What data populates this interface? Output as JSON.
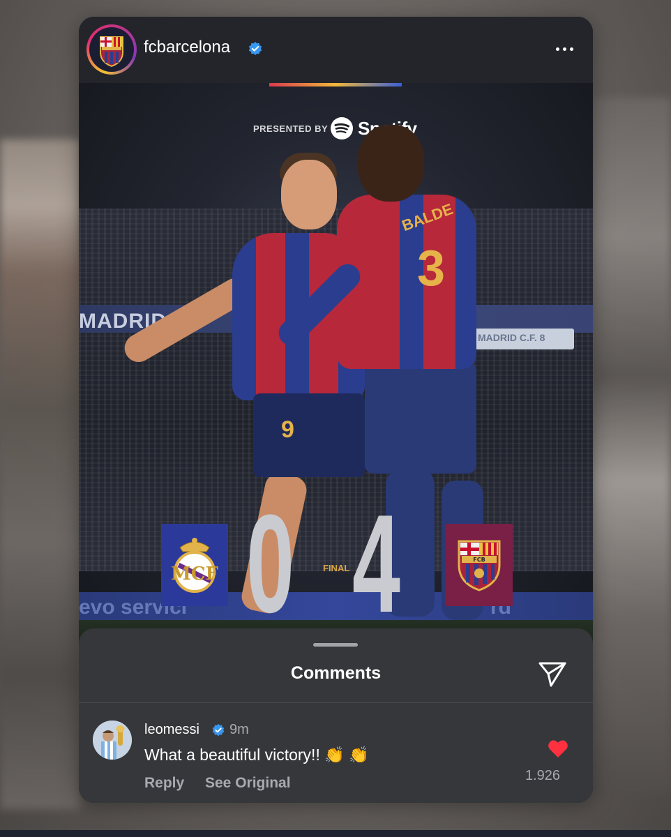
{
  "post": {
    "username": "fcbarcelona",
    "verified": true,
    "more_icon": "more-horizontal-icon"
  },
  "graphic": {
    "presented_by": "PRESENTED BY",
    "sponsor": "Spotify",
    "ad_left": "MADRID C.",
    "ad_right": "MADRID C.F. 8",
    "pitch_left": "evo servici",
    "pitch_right": "rd",
    "player_left_number": "9",
    "player_right_number": "3",
    "player_right_name": "BALDE",
    "score_home": "0",
    "score_away": "4",
    "final_label": "FINAL",
    "home_crest": "real-madrid-crest",
    "away_crest": "fc-barcelona-crest"
  },
  "comments": {
    "title": "Comments",
    "share_icon": "send-icon",
    "items": [
      {
        "username": "leomessi",
        "verified": true,
        "time": "9m",
        "text": "What a beautiful victory!! 👏 👏",
        "reply_label": "Reply",
        "see_original_label": "See Original",
        "likes": "1.926",
        "liked": true
      }
    ]
  },
  "colors": {
    "accent_verified": "#3897f0",
    "heart": "#ff3040",
    "sheet_bg": "#36373b",
    "rm_box": "#2b3a9a",
    "fcb_box": "#7a1f45"
  }
}
